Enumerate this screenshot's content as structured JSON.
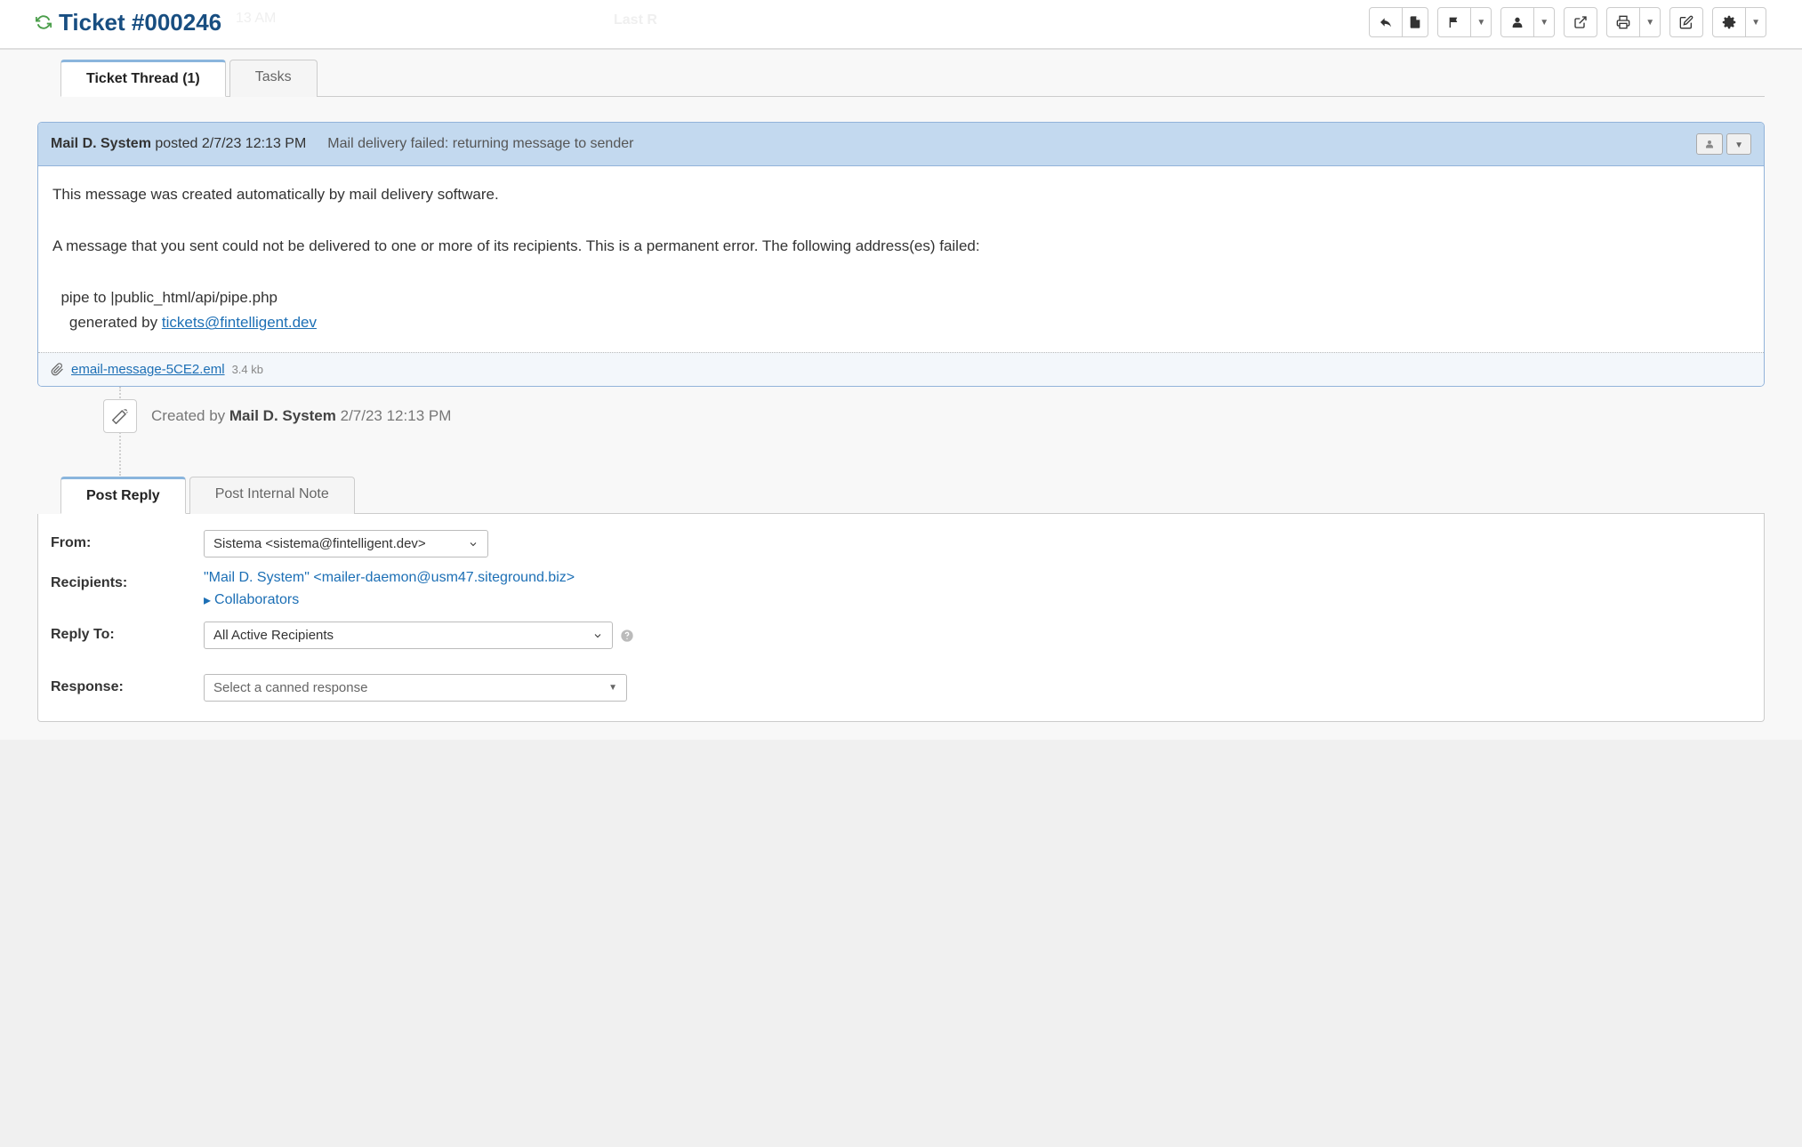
{
  "header": {
    "ticket_title": "Ticket #000246",
    "ghost_time": "13 AM",
    "ghost_last": "Last R"
  },
  "tabs": {
    "thread": "Ticket Thread (1)",
    "tasks": "Tasks"
  },
  "entry": {
    "poster": "Mail D. System",
    "posted_text": " posted 2/7/23 12:13 PM",
    "subject": "Mail delivery failed: returning message to sender",
    "body_line1": "This message was created automatically by mail delivery software.",
    "body_line2": "A message that you sent could not be delivered to one or more of its recipients. This is a permanent error. The following address(es) failed:",
    "body_pipe": "  pipe to |public_html/api/pipe.php",
    "body_gen_prefix": "    generated by ",
    "body_gen_email": "tickets@fintelligent.dev",
    "attachment_name": "email-message-5CE2.eml",
    "attachment_size": "3.4 kb"
  },
  "timeline": {
    "created_prefix": "Created by ",
    "creator": "Mail D. System",
    "created_time": " 2/7/23 12:13 PM"
  },
  "reply_tabs": {
    "post_reply": "Post Reply",
    "post_note": "Post Internal Note"
  },
  "reply_form": {
    "from_label": "From:",
    "from_value": "Sistema <sistema@fintelligent.dev>",
    "recipients_label": "Recipients:",
    "recipients_value": "\"Mail D. System\" <mailer-daemon@usm47.siteground.biz>",
    "collaborators": "Collaborators",
    "reply_to_label": "Reply To:",
    "reply_to_value": "All Active Recipients",
    "response_label": "Response:",
    "response_placeholder": "Select a canned response"
  }
}
